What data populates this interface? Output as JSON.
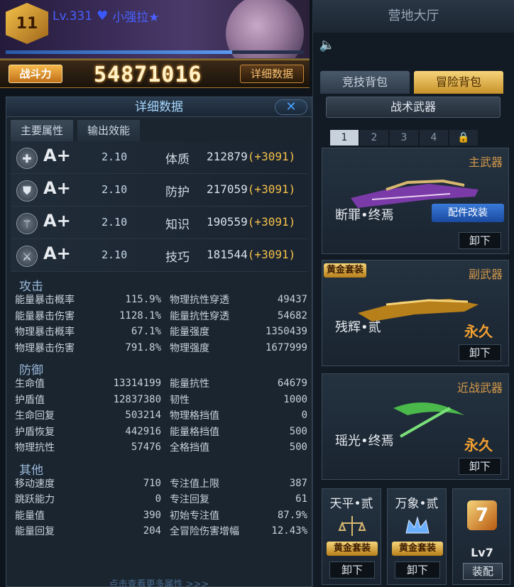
{
  "player": {
    "rank_badge": "11",
    "level": "Lv.331",
    "name": "小强拉★",
    "xp_fraction": 0.76
  },
  "power": {
    "label": "战斗力",
    "value": "54871016",
    "detail_button": "详细数据"
  },
  "detail_panel": {
    "title": "详细数据",
    "close": "✕",
    "tabs": [
      "主要属性",
      "输出效能"
    ],
    "attributes": [
      {
        "icon": "plus-circle-icon",
        "grade": "A+",
        "mult": "2.10",
        "name": "体质",
        "value": "212879",
        "bonus": "(+3091)"
      },
      {
        "icon": "shield-icon",
        "grade": "A+",
        "mult": "2.10",
        "name": "防护",
        "value": "217059",
        "bonus": "(+3091)"
      },
      {
        "icon": "magic-wand-icon",
        "grade": "A+",
        "mult": "2.10",
        "name": "知识",
        "value": "190559",
        "bonus": "(+3091)"
      },
      {
        "icon": "dagger-icon",
        "grade": "A+",
        "mult": "2.10",
        "name": "技巧",
        "value": "181544",
        "bonus": "(+3091)"
      }
    ],
    "sections": [
      {
        "title": "攻击",
        "rows": [
          [
            "能量暴击概率",
            "115.9%",
            "物理抗性穿透",
            "49437"
          ],
          [
            "能量暴击伤害",
            "1128.1%",
            "能量抗性穿透",
            "54682"
          ],
          [
            "物理暴击概率",
            "67.1%",
            "能量强度",
            "1350439"
          ],
          [
            "物理暴击伤害",
            "791.8%",
            "物理强度",
            "1677999"
          ]
        ]
      },
      {
        "title": "防御",
        "rows": [
          [
            "生命值",
            "13314199",
            "能量抗性",
            "64679"
          ],
          [
            "护盾值",
            "12837380",
            "韧性",
            "1000"
          ],
          [
            "生命回复",
            "503214",
            "物理格挡值",
            "0"
          ],
          [
            "护盾恢复",
            "442916",
            "能量格挡值",
            "500"
          ],
          [
            "物理抗性",
            "57476",
            "全格挡值",
            "500"
          ]
        ]
      },
      {
        "title": "其他",
        "rows": [
          [
            "移动速度",
            "710",
            "专注值上限",
            "387"
          ],
          [
            "跳跃能力",
            "0",
            "专注回复",
            "61"
          ],
          [
            "能量值",
            "390",
            "初始专注值",
            "87.9%"
          ],
          [
            "能量回复",
            "204",
            "全冒险伤害增幅",
            "12.43%"
          ]
        ]
      }
    ],
    "footer": "点击查看更多属性 >>>"
  },
  "right_panel": {
    "title": "营地大厅",
    "bag_tabs": [
      "竞技背包",
      "冒险背包"
    ],
    "tactical_button": "战术武器",
    "pages": [
      "1",
      "2",
      "3",
      "4"
    ],
    "primary": {
      "type": "主武器",
      "name": "断罪•终焉",
      "mod_button": "配件改装",
      "unequip": "卸下"
    },
    "secondary": {
      "type": "副武器",
      "tag": "黄金套装",
      "name": "残辉•贰",
      "forever": "永久",
      "unequip": "卸下"
    },
    "melee": {
      "type": "近战武器",
      "name": "瑶光•终焉",
      "forever": "永久",
      "unequip": "卸下"
    },
    "slots": [
      {
        "name": "天平•贰",
        "tag": "黄金套装",
        "unequip": "卸下"
      },
      {
        "name": "万象•贰",
        "tag": "黄金套装",
        "unequip": "卸下"
      }
    ],
    "lv_slot": {
      "icon_text": "7",
      "level": "Lv7",
      "equip": "装配"
    }
  }
}
